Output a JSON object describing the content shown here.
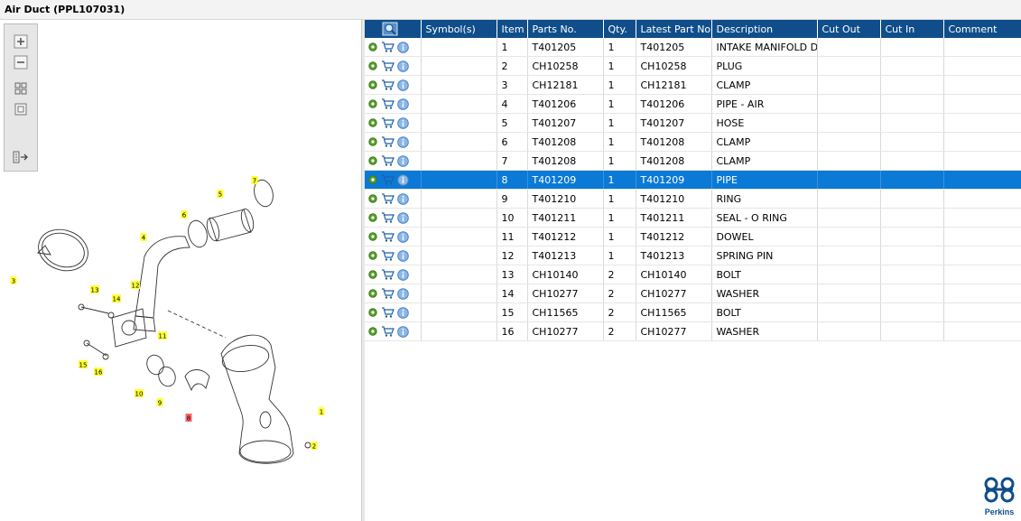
{
  "window": {
    "title": "Air Duct (PPL107031)"
  },
  "toolbar": {
    "buttons": [
      "zoom-in",
      "zoom-out",
      "fit-view",
      "single-view",
      "export"
    ]
  },
  "diagram": {
    "callouts": [
      {
        "label": "7",
        "hl": false
      },
      {
        "label": "5",
        "hl": false
      },
      {
        "label": "6",
        "hl": false
      },
      {
        "label": "4",
        "hl": false
      },
      {
        "label": "3",
        "hl": false
      },
      {
        "label": "13",
        "hl": false
      },
      {
        "label": "12",
        "hl": false
      },
      {
        "label": "14",
        "hl": false
      },
      {
        "label": "11",
        "hl": false
      },
      {
        "label": "15",
        "hl": false
      },
      {
        "label": "16",
        "hl": false
      },
      {
        "label": "10",
        "hl": false
      },
      {
        "label": "9",
        "hl": false
      },
      {
        "label": "8",
        "hl": true
      },
      {
        "label": "1",
        "hl": false
      },
      {
        "label": "2",
        "hl": false
      }
    ]
  },
  "table": {
    "headers": [
      "",
      "Symbol(s)",
      "Item",
      "Parts No.",
      "Qty.",
      "Latest Part No.",
      "Description",
      "Cut Out",
      "Cut In",
      "Comment"
    ],
    "selected_item": "8",
    "rows": [
      {
        "item": "1",
        "part": "T401205",
        "qty": "1",
        "latest": "T401205",
        "desc": "INTAKE MANIFOLD DU"
      },
      {
        "item": "2",
        "part": "CH10258",
        "qty": "1",
        "latest": "CH10258",
        "desc": "PLUG"
      },
      {
        "item": "3",
        "part": "CH12181",
        "qty": "1",
        "latest": "CH12181",
        "desc": "CLAMP"
      },
      {
        "item": "4",
        "part": "T401206",
        "qty": "1",
        "latest": "T401206",
        "desc": "PIPE - AIR"
      },
      {
        "item": "5",
        "part": "T401207",
        "qty": "1",
        "latest": "T401207",
        "desc": "HOSE"
      },
      {
        "item": "6",
        "part": "T401208",
        "qty": "1",
        "latest": "T401208",
        "desc": "CLAMP"
      },
      {
        "item": "7",
        "part": "T401208",
        "qty": "1",
        "latest": "T401208",
        "desc": "CLAMP"
      },
      {
        "item": "8",
        "part": "T401209",
        "qty": "1",
        "latest": "T401209",
        "desc": "PIPE"
      },
      {
        "item": "9",
        "part": "T401210",
        "qty": "1",
        "latest": "T401210",
        "desc": "RING"
      },
      {
        "item": "10",
        "part": "T401211",
        "qty": "1",
        "latest": "T401211",
        "desc": "SEAL - O RING"
      },
      {
        "item": "11",
        "part": "T401212",
        "qty": "1",
        "latest": "T401212",
        "desc": "DOWEL"
      },
      {
        "item": "12",
        "part": "T401213",
        "qty": "1",
        "latest": "T401213",
        "desc": "SPRING PIN"
      },
      {
        "item": "13",
        "part": "CH10140",
        "qty": "2",
        "latest": "CH10140",
        "desc": "BOLT"
      },
      {
        "item": "14",
        "part": "CH10277",
        "qty": "2",
        "latest": "CH10277",
        "desc": "WASHER"
      },
      {
        "item": "15",
        "part": "CH11565",
        "qty": "2",
        "latest": "CH11565",
        "desc": "BOLT"
      },
      {
        "item": "16",
        "part": "CH10277",
        "qty": "2",
        "latest": "CH10277",
        "desc": "WASHER"
      }
    ]
  },
  "brand": {
    "name": "Perkins",
    "color": "#0f4e8a"
  },
  "colors": {
    "header": "#0f4e8a",
    "selection": "#0a7ad6",
    "callout": "#ffff33",
    "callout_selected": "#ff6666"
  }
}
